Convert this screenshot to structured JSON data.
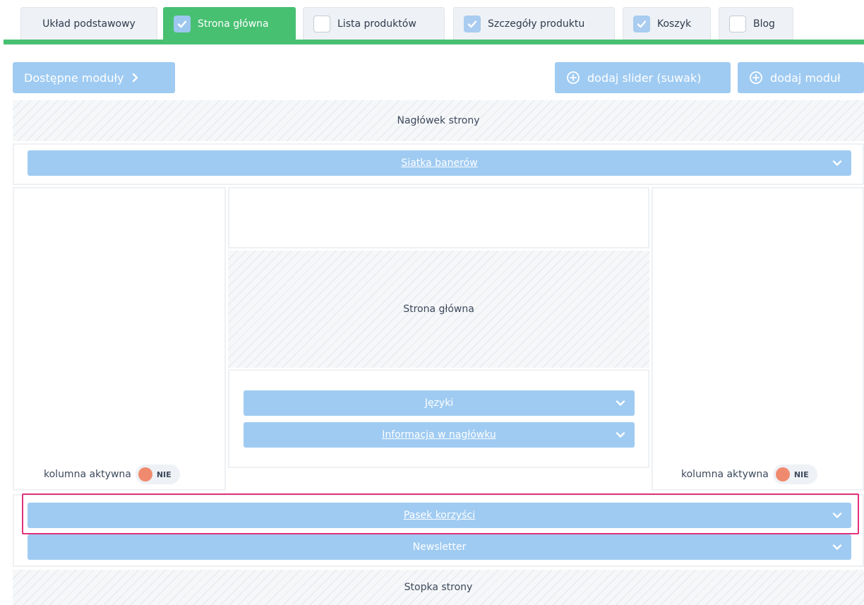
{
  "tabs": [
    {
      "label": "Układ podstawowy",
      "checkbox": null
    },
    {
      "label": "Strona główna",
      "checkbox": "checked",
      "active": true
    },
    {
      "label": "Lista produktów",
      "checkbox": "unchecked"
    },
    {
      "label": "Szczegóły produktu",
      "checkbox": "checked"
    },
    {
      "label": "Koszyk",
      "checkbox": "checked"
    },
    {
      "label": "Blog",
      "checkbox": "unchecked"
    }
  ],
  "toolbar": {
    "available_modules": "Dostępne moduły",
    "add_slider": "dodaj slider (suwak)",
    "add_module": "dodaj moduł"
  },
  "regions": {
    "header": "Nagłówek strony",
    "home": "Strona główna",
    "footer": "Stopka strony"
  },
  "modules": {
    "banner_grid": "Siatka banerów",
    "languages": "Języki",
    "header_info": "Informacja w nagłówku",
    "benefits_bar": "Pasek korzyści",
    "newsletter": "Newsletter"
  },
  "columns": {
    "left": {
      "label": "kolumna aktywna",
      "state": "NIE"
    },
    "right": {
      "label": "kolumna aktywna",
      "state": "NIE"
    }
  },
  "colors": {
    "accent_green": "#48c072",
    "module_blue": "#9fcbf2",
    "toggle_off": "#f08a6e",
    "highlight": "#e0317a"
  }
}
